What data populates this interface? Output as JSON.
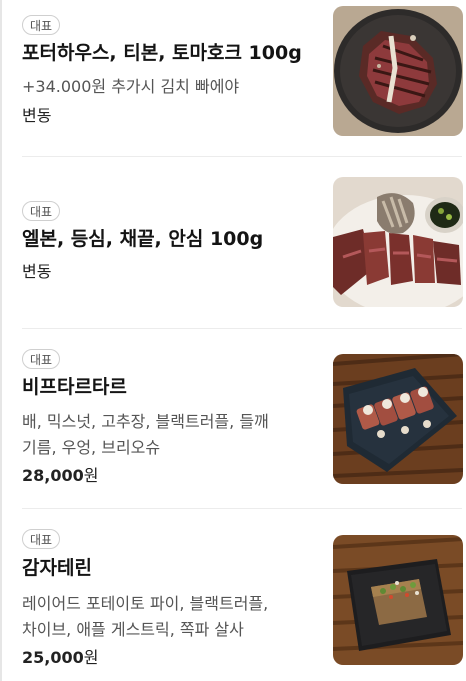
{
  "menu": {
    "items": [
      {
        "badge": "대표",
        "name": "포터하우스, 티본, 토마호크 100g",
        "description": "+34.000원 추가시 김치 빠에야",
        "price": "변동",
        "price_unit": "",
        "image": "porterhouse-steak-photo"
      },
      {
        "badge": "대표",
        "name": "엘본, 등심, 채끝, 안심 100g",
        "description": "",
        "price": "변동",
        "price_unit": "",
        "image": "sliced-steak-platter-photo"
      },
      {
        "badge": "대표",
        "name": "비프타르타르",
        "description_line1": "배, 믹스넛, 고추장, 블랙트러플, 들깨",
        "description_line2": "기름, 우엉, 브리오슈",
        "price": "28,000",
        "price_unit": "원",
        "image": "beef-tartare-photo"
      },
      {
        "badge": "대표",
        "name": "감자테린",
        "description_line1": "레이어드 포테이토 파이, 블랙트러플,",
        "description_line2": "차이브, 애플 게스트릭, 쪽파 살사",
        "price": "25,000",
        "price_unit": "원",
        "image": "potato-terrine-photo"
      }
    ]
  },
  "colors": {
    "title": "#141414",
    "description": "#555555",
    "badge_border": "#cfcfcf",
    "divider": "#ececec"
  }
}
